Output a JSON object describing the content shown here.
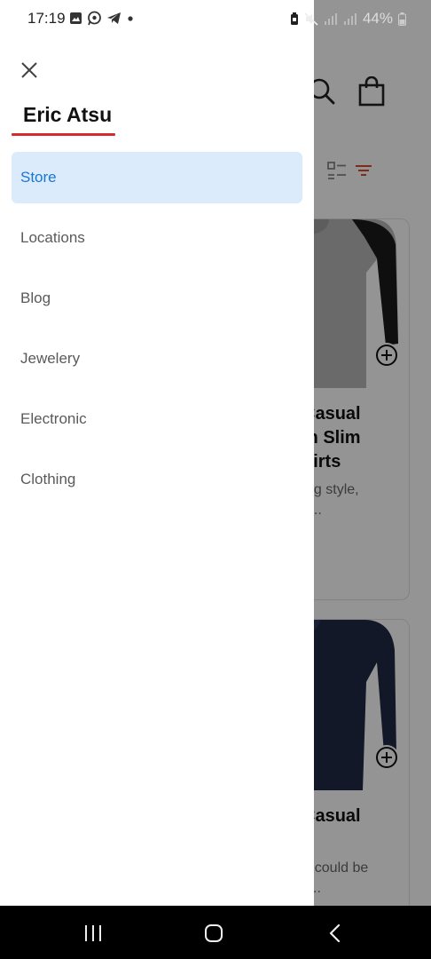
{
  "status_bar": {
    "time": "17:19",
    "battery_percent": "44%",
    "left_icons": [
      "gallery-icon",
      "whatsapp-icon",
      "telegram-icon",
      "dot-icon"
    ],
    "right_icons": [
      "battery-saver-icon",
      "mute-icon",
      "signal-icon",
      "signal-icon",
      "battery-icon"
    ]
  },
  "drawer": {
    "user_name": "Eric Atsu",
    "accent_color": "#d62b2b",
    "active_color": "#1976d2",
    "active_bg": "#dcebfb",
    "items": [
      {
        "label": "Store",
        "active": true
      },
      {
        "label": "Locations",
        "active": false
      },
      {
        "label": "Blog",
        "active": false
      },
      {
        "label": "Jewelery",
        "active": false
      },
      {
        "label": "Electronic",
        "active": false
      },
      {
        "label": "Clothing",
        "active": false
      }
    ]
  },
  "background_app": {
    "header_icons": [
      "search-icon",
      "shopping-bag-icon"
    ],
    "toolbar_icons": [
      "list-view-icon",
      "filter-icon"
    ],
    "products": [
      {
        "title": "Casual\nm Slim\nhirts",
        "description": "ng style,\nr..."
      },
      {
        "title": "Casual\nt",
        "description": "r could be\ni..."
      }
    ]
  }
}
